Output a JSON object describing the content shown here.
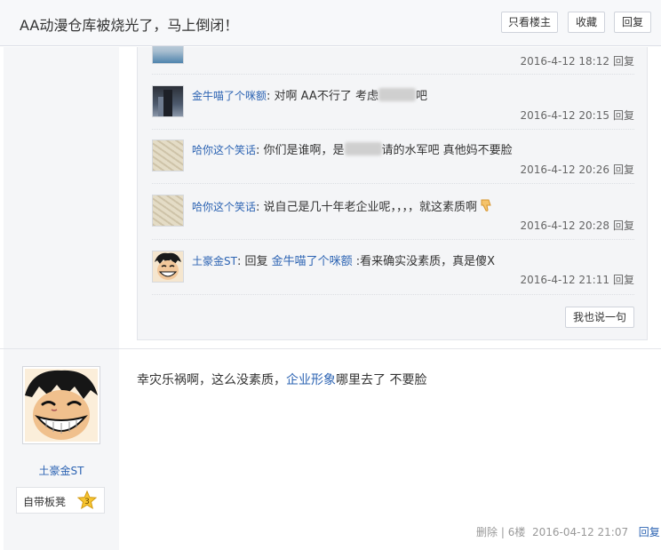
{
  "header": {
    "title": "AA动漫仓库被烧光了，马上倒闭！",
    "only_op": "只看楼主",
    "favorite": "收藏",
    "reply": "回复"
  },
  "sub_replies": [
    {
      "text": "",
      "time": "2016-4-12 18:12",
      "reply": "回复"
    },
    {
      "user": "金牛喵了个咪额",
      "sep": ":",
      "text_before": " 对啊 AA不行了 考虑",
      "text_after": "吧",
      "time": "2016-4-12 20:15",
      "reply": "回复"
    },
    {
      "user": "哈你这个笑话",
      "sep": ":",
      "text_before": " 你们是谁啊，是",
      "text_after": "请的水军吧 真他妈不要脸",
      "time": "2016-4-12 20:26",
      "reply": "回复"
    },
    {
      "user": "哈你这个笑话",
      "sep": ":",
      "text": " 说自己是几十年老企业呢，，，，就这素质啊",
      "emoji": "thumbs-down-icon",
      "time": "2016-4-12 20:28",
      "reply": "回复"
    },
    {
      "user": "土豪金ST",
      "sep": ":",
      "reply_word": " 回复 ",
      "reply_target": "金牛喵了个咪额",
      "text": " :看来确实没素质，真是傻X",
      "time": "2016-4-12 21:11",
      "reply": "回复"
    }
  ],
  "say_button": "我也说一句",
  "post": {
    "username": "土豪金ST",
    "badge_label": "自带板凳",
    "badge_level": "3",
    "content_before": "幸灾乐祸啊，这么没素质，",
    "content_link": "企业形象",
    "content_after": "哪里去了 不要脸",
    "delete": "删除",
    "divider": " | ",
    "floor": "6楼",
    "time": "2016-04-12 21:07",
    "reply": "回复"
  },
  "colors": {
    "link": "#2d64b3",
    "panel_bg": "#f4f5f7",
    "left_col_bg": "#f5f6f8"
  }
}
